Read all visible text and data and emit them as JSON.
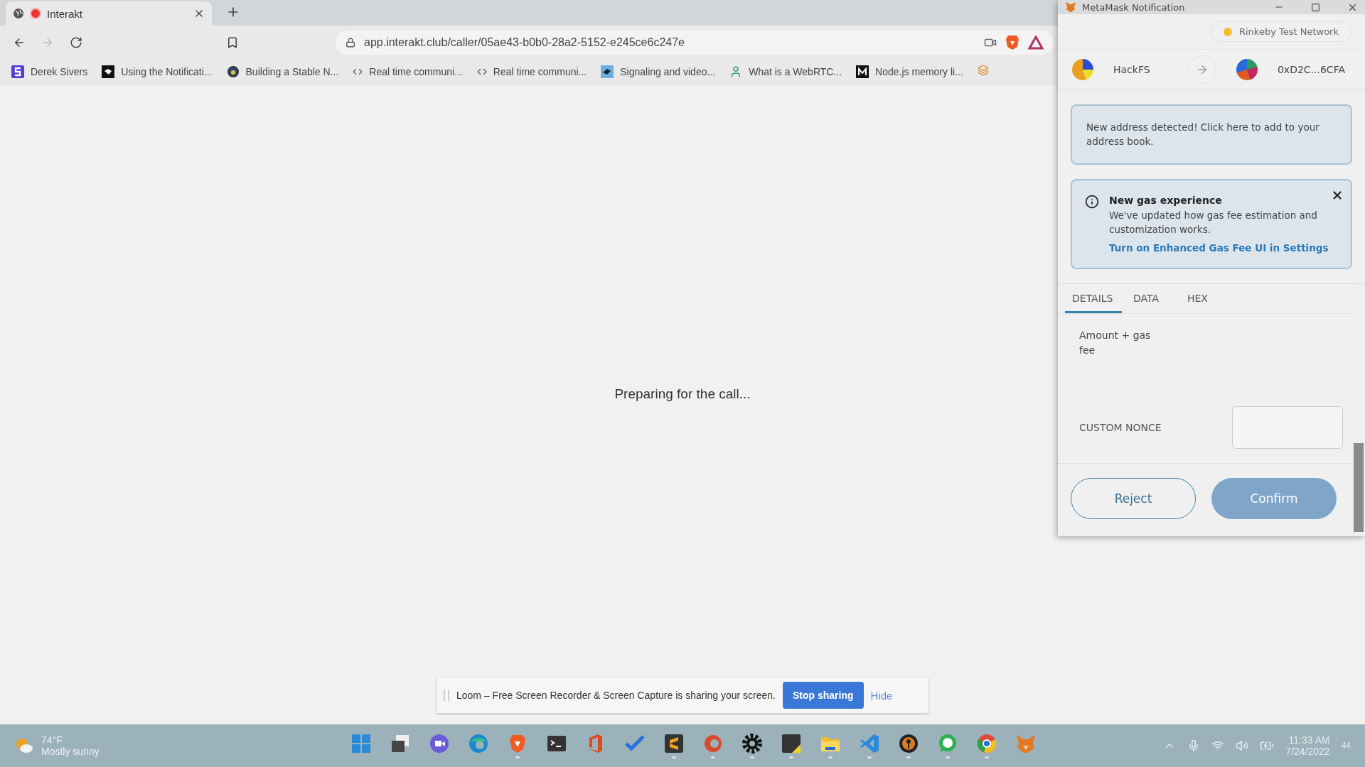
{
  "browser": {
    "tab": {
      "title": "Interakt",
      "recording": true
    },
    "address": "app.interakt.club/caller/05ae43-b0b0-28a2-5152-e245ce6c247e",
    "bookmarks": [
      {
        "kind": "s-logo",
        "label": "Derek Sivers"
      },
      {
        "kind": "dark-tile",
        "label": "Using the Notificati..."
      },
      {
        "kind": "ring",
        "label": "Building a Stable N..."
      },
      {
        "kind": "code",
        "label": "Real time communi..."
      },
      {
        "kind": "code",
        "label": "Real time communi..."
      },
      {
        "kind": "bird-tile",
        "label": "Signaling and video..."
      },
      {
        "kind": "person",
        "label": "What is a WebRTC..."
      },
      {
        "kind": "m-tile",
        "label": "Node.js memory li..."
      },
      {
        "kind": "stack"
      }
    ]
  },
  "page": {
    "message": "Preparing for the call..."
  },
  "loom_bar": {
    "message": "Loom – Free Screen Recorder & Screen Capture is sharing your screen.",
    "stop_button": "Stop sharing",
    "hide_link": "Hide"
  },
  "metamask": {
    "title": "MetaMask Notification",
    "network": "Rinkeby Test Network",
    "from": "HackFS",
    "to": "0xD2C...6CFA",
    "address_notice": "New address detected! Click here to add to your address book.",
    "gas_notice": {
      "title": "New gas experience",
      "body": "We've updated how gas fee estimation and customization works.",
      "link": "Turn on Enhanced Gas Fee UI in Settings"
    },
    "tabs": [
      {
        "label": "DETAILS",
        "selected": true
      },
      {
        "label": "DATA",
        "selected": false
      },
      {
        "label": "HEX",
        "selected": false
      }
    ],
    "amount_label": "Amount + gas fee",
    "nonce_label": "CUSTOM NONCE",
    "buttons": [
      {
        "label": "Reject",
        "kind": "secondary",
        "disabled": false
      },
      {
        "label": "Confirm",
        "kind": "primary",
        "disabled": true
      }
    ]
  },
  "taskbar": {
    "weather": {
      "temp": "74°F",
      "condition": "Mostly sunny"
    },
    "apps": [
      {
        "kind": "start",
        "running": false
      },
      {
        "kind": "taskview",
        "running": false
      },
      {
        "kind": "chat",
        "running": false
      },
      {
        "kind": "edge",
        "running": false
      },
      {
        "kind": "brave",
        "running": true
      },
      {
        "kind": "terminal",
        "running": false
      },
      {
        "kind": "office",
        "running": false
      },
      {
        "kind": "todo",
        "running": false
      },
      {
        "kind": "sublime",
        "running": true
      },
      {
        "kind": "ccleaner",
        "running": true
      },
      {
        "kind": "settings",
        "running": true
      },
      {
        "kind": "sticky",
        "running": true
      },
      {
        "kind": "files",
        "running": true
      },
      {
        "kind": "vscode",
        "running": true
      },
      {
        "kind": "key",
        "running": true
      },
      {
        "kind": "whatsapp",
        "running": true
      },
      {
        "kind": "chrome",
        "running": true
      },
      {
        "kind": "fox",
        "running": false
      }
    ],
    "time": "11:33 AM",
    "date": "7/24/2022",
    "notifications": "44"
  }
}
